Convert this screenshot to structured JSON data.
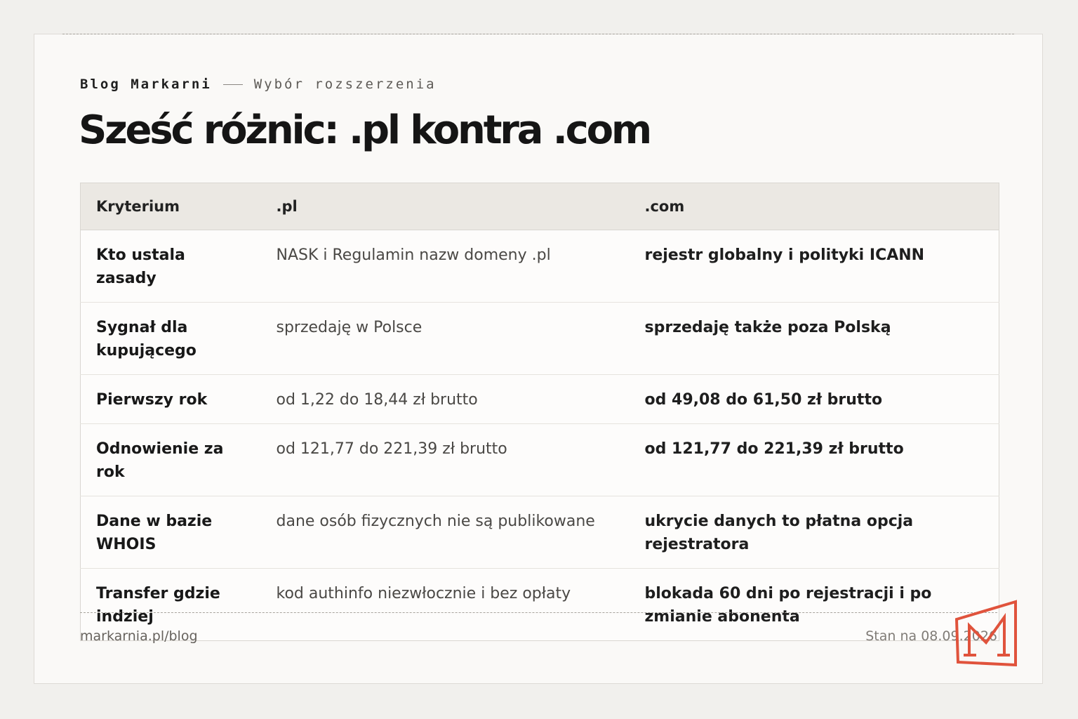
{
  "header": {
    "brand": "Blog Markarni",
    "section": "Wybór rozszerzenia",
    "title": "Sześć różnic: .pl kontra .com"
  },
  "table": {
    "columns": [
      "Kryterium",
      ".pl",
      ".com"
    ],
    "rows": [
      {
        "criterion": "Kto ustala zasady",
        "pl": "NASK i Regulamin nazw domeny .pl",
        "com": "rejestr globalny i polityki ICANN"
      },
      {
        "criterion": "Sygnał dla kupującego",
        "pl": "sprzedaję w Polsce",
        "com": "sprzedaję także poza Polską"
      },
      {
        "criterion": "Pierwszy rok",
        "pl": "od 1,22 do 18,44 zł brutto",
        "com": "od 49,08 do 61,50 zł brutto"
      },
      {
        "criterion": "Odnowienie za rok",
        "pl": "od 121,77 do 221,39 zł brutto",
        "com": "od 121,77 do 221,39 zł brutto"
      },
      {
        "criterion": "Dane w bazie WHOIS",
        "pl": "dane osób fizycznych nie są publikowane",
        "com": "ukrycie danych to płatna opcja rejestratora"
      },
      {
        "criterion": "Transfer gdzie indziej",
        "pl": "kod authinfo niezwłocznie i bez opłaty",
        "com": "blokada 60 dni po rejestracji i po zmianie abonenta"
      }
    ]
  },
  "footer": {
    "url": "markarnia.pl/blog",
    "date": "Stan na 08.09.2026"
  },
  "logo": {
    "icon": "markarnia-m-logo-icon",
    "color": "#e0533c"
  }
}
